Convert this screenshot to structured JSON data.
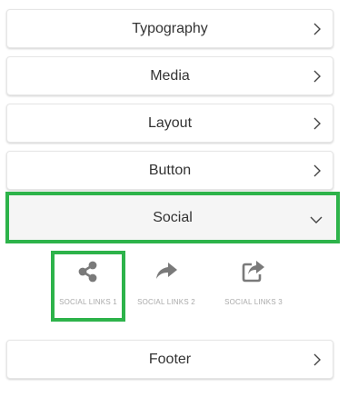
{
  "sections": {
    "typography": "Typography",
    "media": "Media",
    "layout": "Layout",
    "button": "Button",
    "social": "Social",
    "footer": "Footer"
  },
  "social_options": [
    {
      "label": "SOCIAL LINKS 1",
      "icon": "share-nodes-icon",
      "selected": true
    },
    {
      "label": "SOCIAL LINKS 2",
      "icon": "share-arrow-icon",
      "selected": false
    },
    {
      "label": "SOCIAL LINKS 3",
      "icon": "share-square-icon",
      "selected": false
    }
  ],
  "colors": {
    "highlight": "#2db34a",
    "icon": "#7a7a7a",
    "caption": "#aaaaaa"
  }
}
